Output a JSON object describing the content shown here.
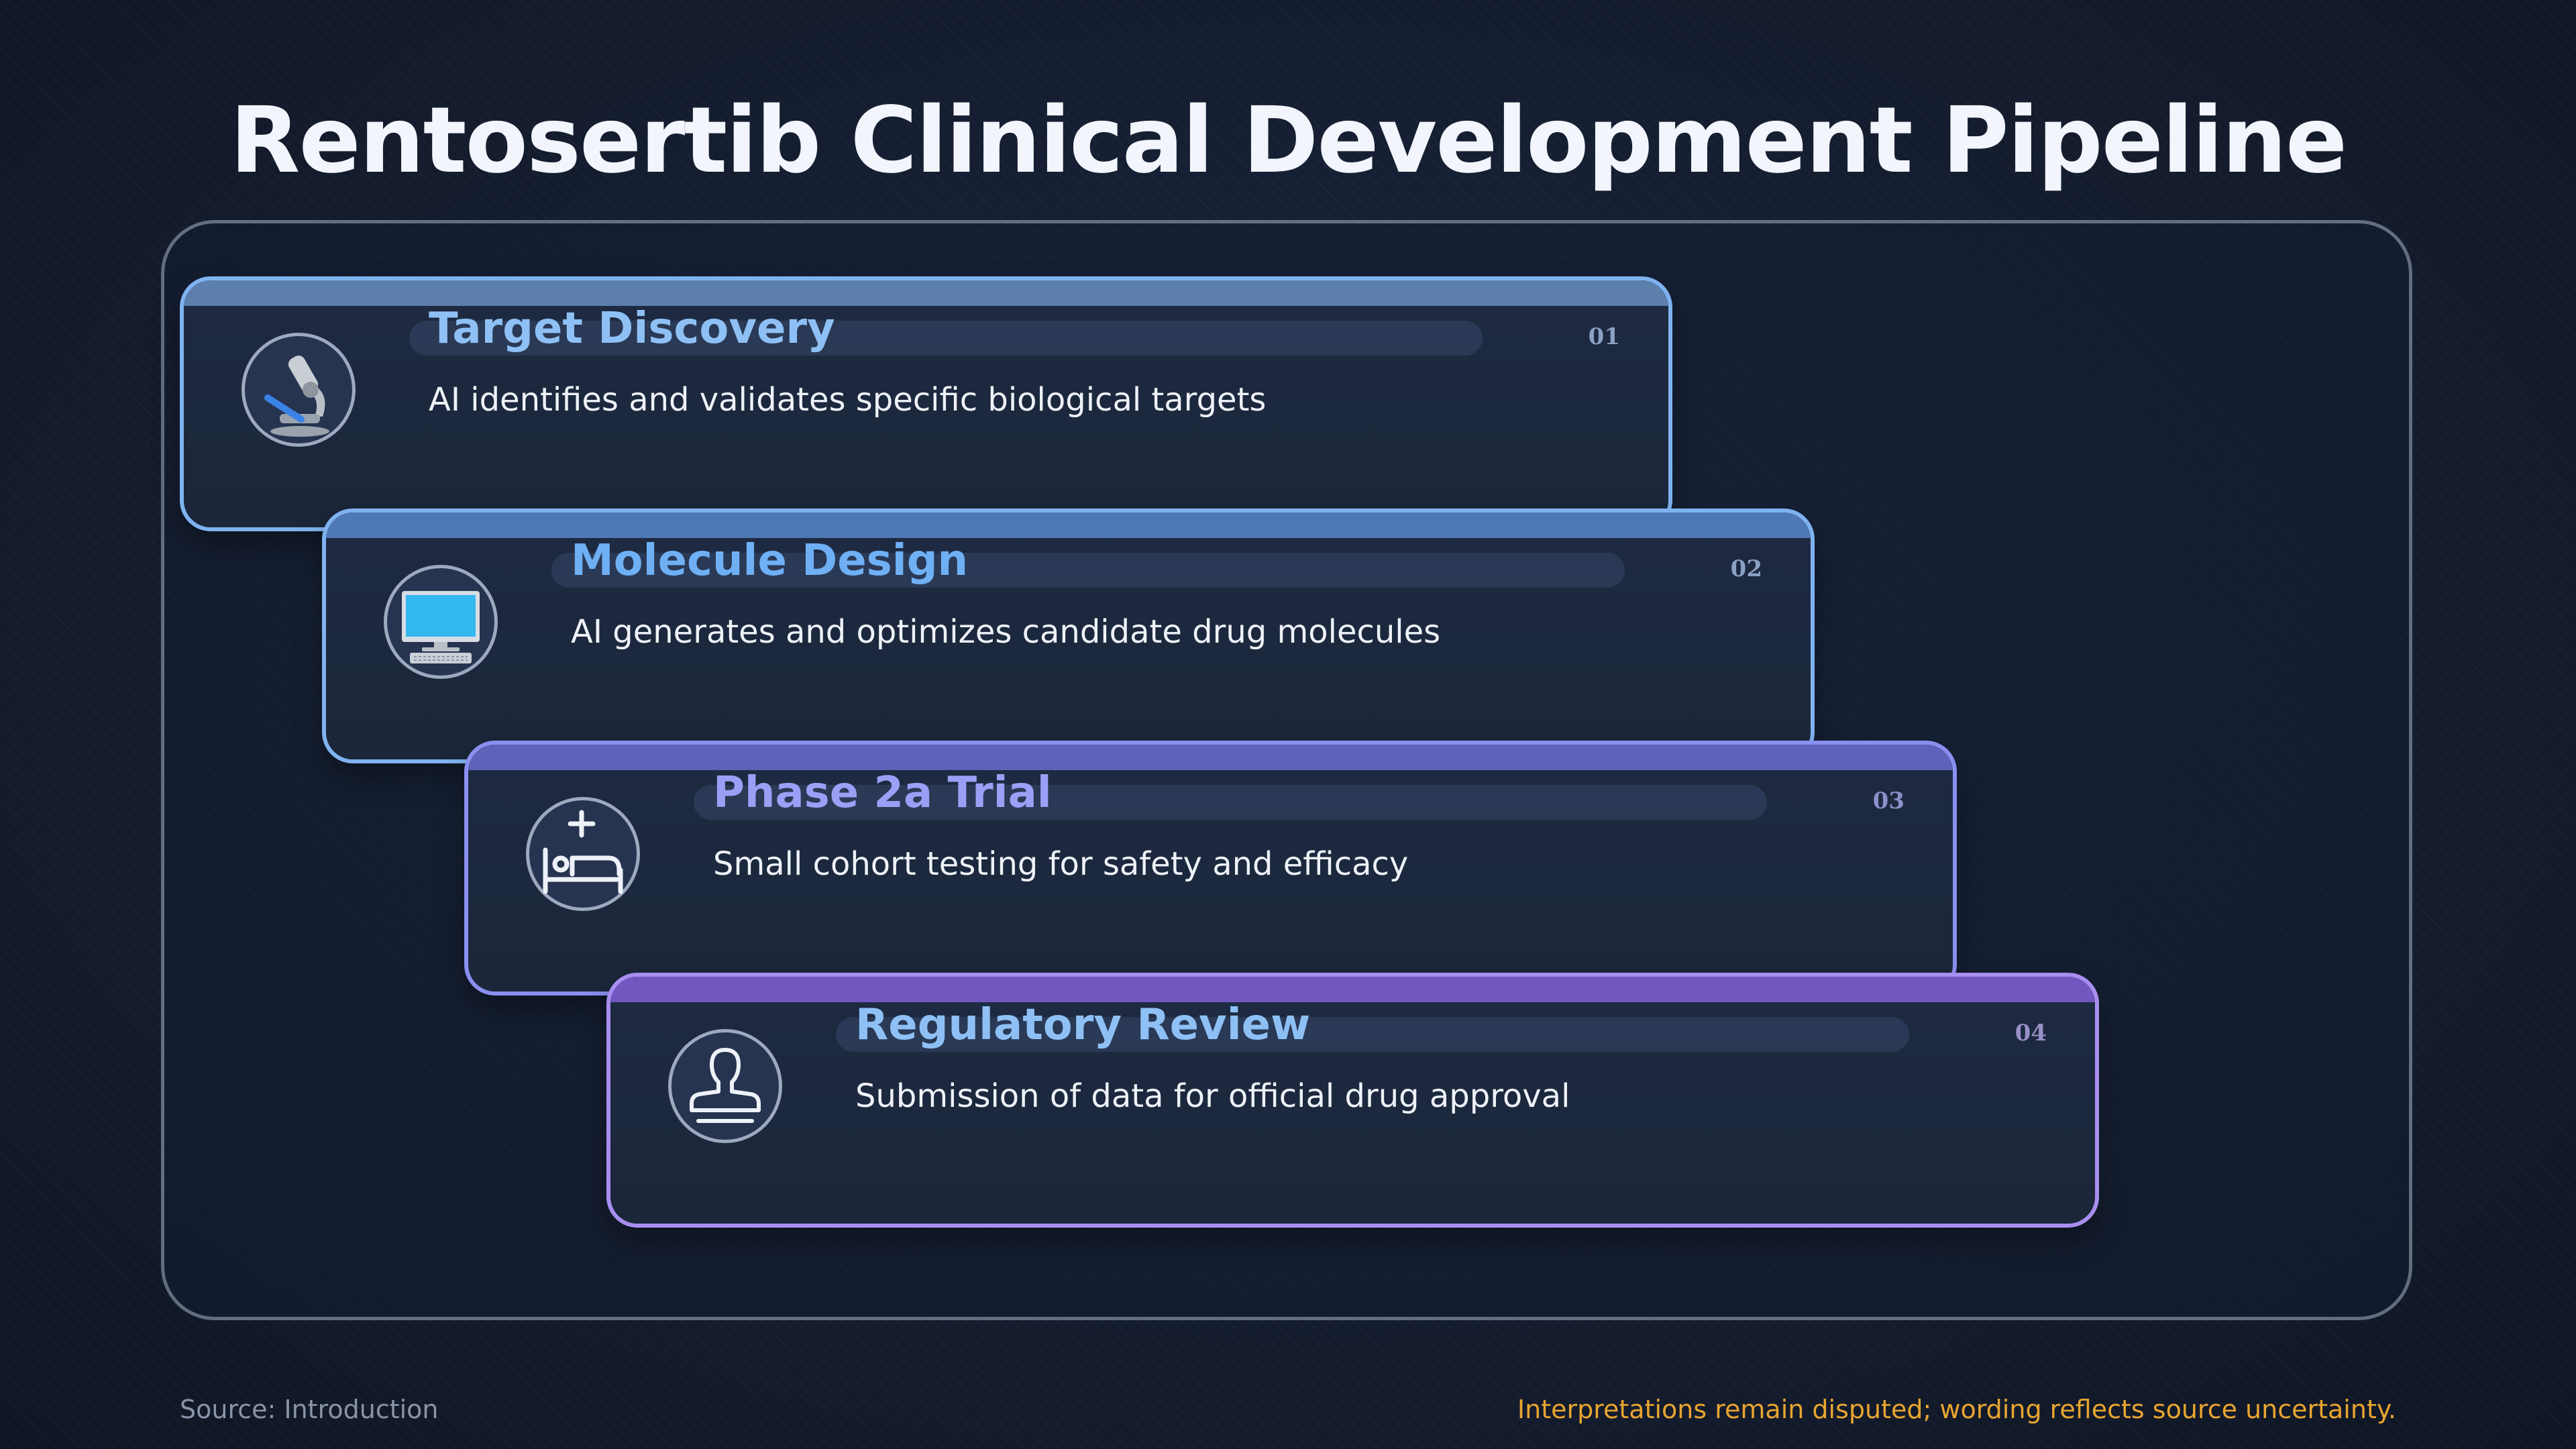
{
  "title": "Rentosertib Clinical Development Pipeline",
  "colors": {
    "background": "#141d2f",
    "blue_accent": "#7fb3f0",
    "indigo_accent": "#8a8ff0",
    "purple_accent": "#a98ef0",
    "note": "#e8a530"
  },
  "steps": [
    {
      "number": "01",
      "title": "Target Discovery",
      "description": "AI identifies and validates specific biological targets",
      "icon": "microscope-icon"
    },
    {
      "number": "02",
      "title": "Molecule Design",
      "description": "AI generates and optimizes candidate drug molecules",
      "icon": "computer-icon"
    },
    {
      "number": "03",
      "title": "Phase 2a Trial",
      "description": "Small cohort testing for safety and efficacy",
      "icon": "hospital-bed-icon"
    },
    {
      "number": "04",
      "title": "Regulatory Review",
      "description": "Submission of data for official drug approval",
      "icon": "stamp-icon"
    }
  ],
  "footer": {
    "source": "Source: Introduction",
    "note": "Interpretations remain disputed; wording reflects source uncertainty."
  }
}
